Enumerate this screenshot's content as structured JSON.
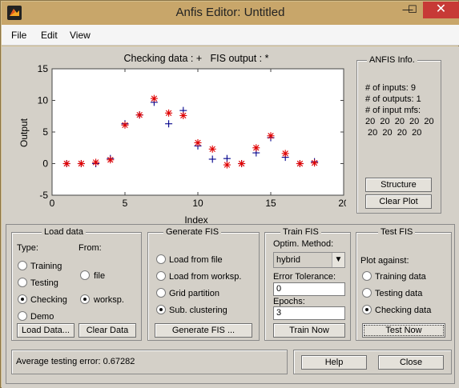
{
  "window": {
    "title": "Anfis Editor: Untitled",
    "minimize": "—",
    "maximize": "☐",
    "close": "✕"
  },
  "menu": [
    "File",
    "Edit",
    "View"
  ],
  "plot": {
    "title": "Checking data : +   FIS output : *",
    "xlabel": "Index",
    "ylabel": "Output",
    "xticks": [
      "0",
      "5",
      "10",
      "15",
      "20"
    ],
    "yticks": [
      "15",
      "10",
      "5",
      "0",
      "-5"
    ]
  },
  "chart_data": {
    "type": "scatter",
    "title": "Checking data : +   FIS output : *",
    "xlabel": "Index",
    "ylabel": "Output",
    "xlim": [
      0,
      20
    ],
    "ylim": [
      -5,
      15
    ],
    "series": [
      {
        "name": "Checking data",
        "marker": "+",
        "color": "#00008b",
        "x": [
          1,
          2,
          3,
          4,
          5,
          6,
          7,
          8,
          9,
          10,
          11,
          12,
          13,
          14,
          15,
          16,
          17,
          18
        ],
        "y": [
          0,
          0,
          0,
          0.8,
          6.3,
          7.7,
          9.7,
          6.3,
          8.4,
          2.8,
          0.7,
          0.8,
          0,
          1.7,
          4.1,
          1,
          0,
          0.3
        ]
      },
      {
        "name": "FIS output",
        "marker": "*",
        "color": "#e00000",
        "x": [
          1,
          2,
          3,
          4,
          5,
          6,
          7,
          8,
          9,
          10,
          11,
          12,
          13,
          14,
          15,
          16,
          17,
          18
        ],
        "y": [
          0,
          0,
          0.2,
          0.6,
          6.1,
          7.7,
          10.3,
          8,
          7.6,
          3.3,
          2.3,
          -0.2,
          0,
          2.5,
          4.4,
          1.6,
          0,
          0.1
        ]
      }
    ]
  },
  "info": {
    "title": "ANFIS Info.",
    "lines": [
      "# of inputs: 9",
      "# of outputs: 1",
      "# of input mfs:",
      "20  20  20  20  20",
      " 20  20  20  20"
    ],
    "structure_btn": "Structure",
    "clear_plot_btn": "Clear Plot"
  },
  "load": {
    "title": "Load data",
    "type_label": "Type:",
    "from_label": "From:",
    "types": [
      "Training",
      "Testing",
      "Checking",
      "Demo"
    ],
    "sources": [
      "file",
      "worksp."
    ],
    "load_btn": "Load Data...",
    "clear_btn": "Clear Data"
  },
  "generate": {
    "title": "Generate FIS",
    "options": [
      "Load from file",
      "Load from worksp.",
      "Grid partition",
      "Sub. clustering"
    ],
    "btn": "Generate FIS ..."
  },
  "train": {
    "title": "Train FIS",
    "method_label": "Optim. Method:",
    "method": "hybrid",
    "tol_label": "Error Tolerance:",
    "tol": "0",
    "epochs_label": "Epochs:",
    "epochs": "3",
    "btn": "Train Now"
  },
  "test": {
    "title": "Test FIS",
    "against_label": "Plot against:",
    "options": [
      "Training data",
      "Testing data",
      "Checking data"
    ],
    "btn": "Test Now"
  },
  "status": {
    "text": "Average testing error: 0.67282"
  },
  "help_btn": "Help",
  "close_btn": "Close"
}
